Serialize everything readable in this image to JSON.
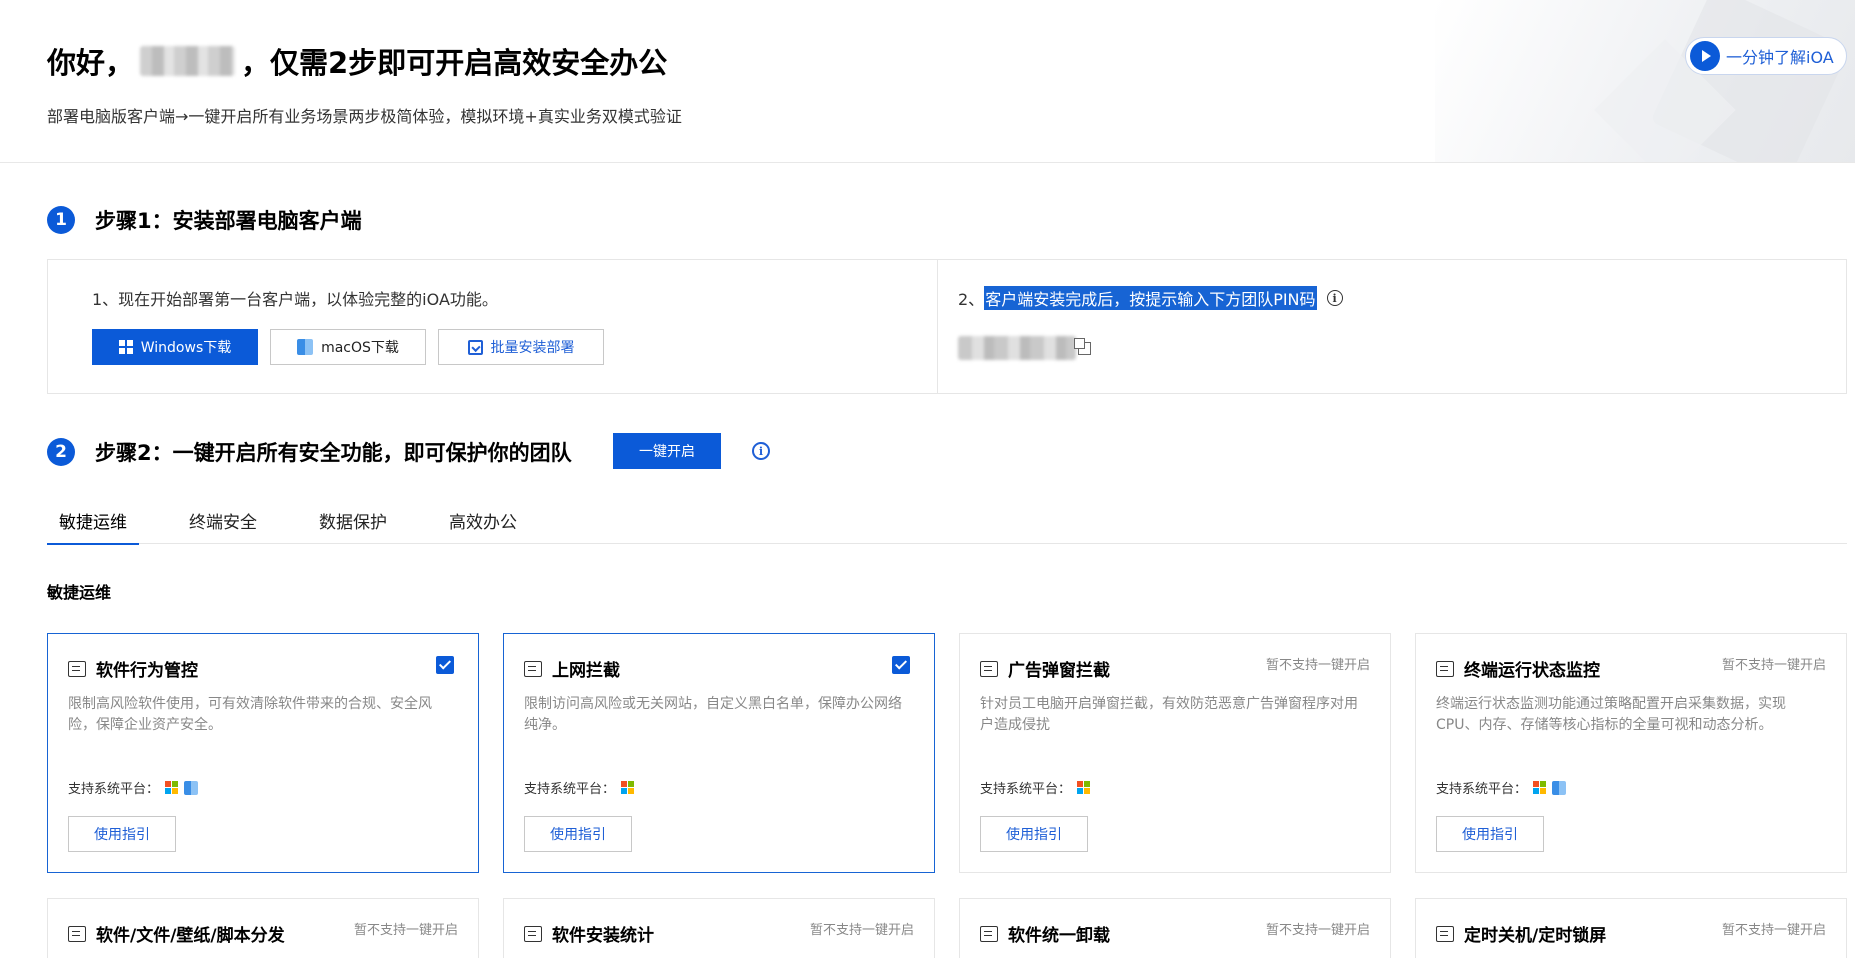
{
  "header": {
    "greeting_prefix": "你好，",
    "greeting_suffix": "，仅需2步即可开启高效安全办公",
    "subtitle": "部署电脑版客户端→一键开启所有业务场景两步极简体验，模拟环境+真实业务双模式验证",
    "video_button": "一分钟了解iOA"
  },
  "step1": {
    "number": "1",
    "title": "步骤1：安装部署电脑客户端",
    "left_text": "1、现在开始部署第一台客户端，以体验完整的iOA功能。",
    "buttons": {
      "windows": "Windows下载",
      "mac": "macOS下载",
      "batch": "批量安装部署"
    },
    "right_prefix": "2、",
    "right_text": "客户端安装完成后，按提示输入下方团队PIN码"
  },
  "step2": {
    "number": "2",
    "title": "步骤2：一键开启所有安全功能，即可保护你的团队",
    "enable_button": "一键开启"
  },
  "tabs": [
    "敏捷运维",
    "终端安全",
    "数据保护",
    "高效办公"
  ],
  "section_label": "敏捷运维",
  "common": {
    "platform_label": "支持系统平台：",
    "guide_button": "使用指引",
    "unsupported": "暂不支持一键开启"
  },
  "cards": [
    {
      "title": "软件行为管控",
      "desc": "限制高风险软件使用，可有效清除软件带来的合规、安全风险，保障企业资产安全。"
    },
    {
      "title": "上网拦截",
      "desc": "限制访问高风险或无关网站，自定义黑白名单，保障办公网络纯净。"
    },
    {
      "title": "广告弹窗拦截",
      "desc": "针对员工电脑开启弹窗拦截，有效防范恶意广告弹窗程序对用户造成侵扰"
    },
    {
      "title": "终端运行状态监控",
      "desc": "终端运行状态监测功能通过策略配置开启采集数据，实现CPU、内存、存储等核心指标的全量可视和动态分析。"
    }
  ],
  "cards_row2": [
    {
      "title": "软件/文件/壁纸/脚本分发"
    },
    {
      "title": "软件安装统计"
    },
    {
      "title": "软件统一卸载"
    },
    {
      "title": "定时关机/定时锁屏"
    }
  ],
  "colors": {
    "primary": "#0b5ad8",
    "highlight": "#1764d4"
  }
}
